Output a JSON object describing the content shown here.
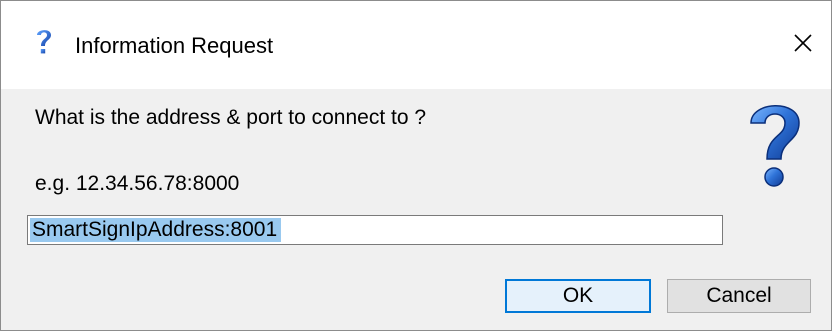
{
  "dialog": {
    "title": "Information Request",
    "title_icon": "question-mark-icon",
    "close_icon": "close-icon",
    "prompt": "What is the address & port to connect to ?",
    "example": "e.g. 12.34.56.78:8000",
    "big_icon": "question-mark-icon",
    "input": {
      "value": "SmartSignIpAddress:8001",
      "selected": true
    },
    "buttons": {
      "ok_label": "OK",
      "cancel_label": "Cancel"
    }
  },
  "colors": {
    "accent": "#0078d7",
    "question_icon": "#1a5fb4",
    "selection": "#99c9ef",
    "body_bg": "#f0f0f0"
  }
}
